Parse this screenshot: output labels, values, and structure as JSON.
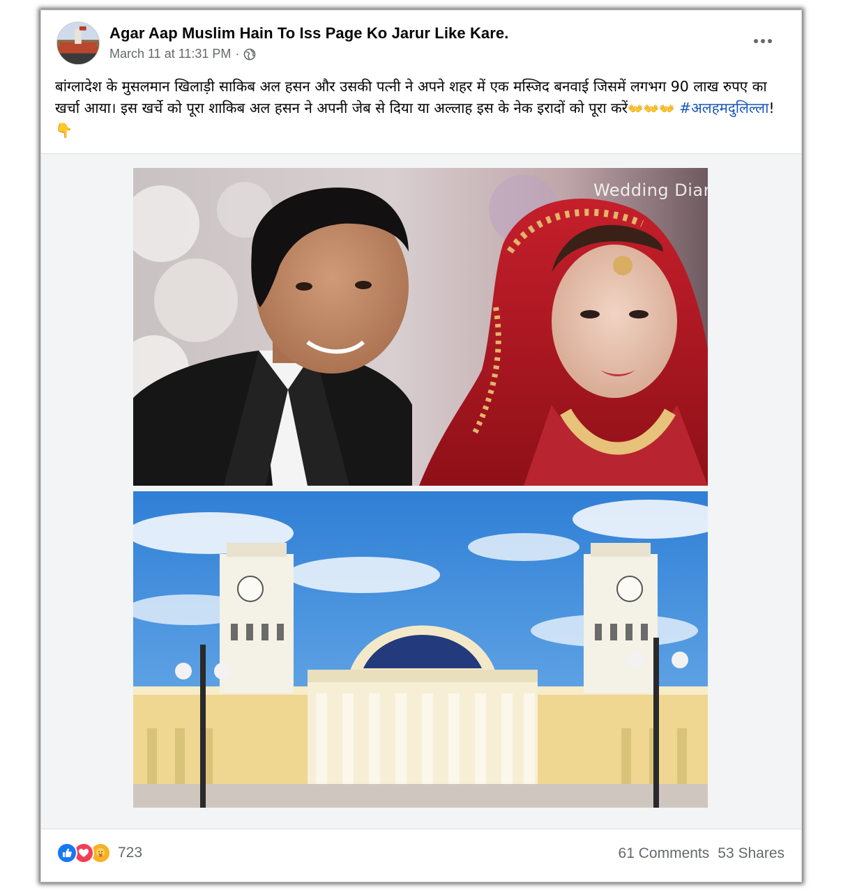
{
  "post": {
    "page_name": "Agar Aap Muslim Hain To Iss Page Ko Jarur Like Kare.",
    "timestamp": "March 11 at 11:31 PM",
    "separator": "·",
    "privacy_icon": "globe-icon",
    "text": "बांग्लादेश के मुसलमान खिलाड़ी साकिब अल हसन और उसकी पत्नी ने अपने शहर में एक मस्जिद बनवाई जिसमें लगभग 90 लाख रुपए का खर्चा आया। इस खर्चे को पूरा शाकिब अल हसन ने अपनी जेब से दिया या अल्लाह इस के नेक इरादों को पूरा करें",
    "emojis": "👐👐👐",
    "hashtag": "#अलहमदुलिल्ला",
    "trailing": "!👇"
  },
  "media": {
    "watermark": "Wedding Diar"
  },
  "footer": {
    "reaction_icons": [
      "like-icon",
      "love-icon",
      "care-icon"
    ],
    "reaction_count": "723",
    "comments": "61 Comments",
    "shares": "53 Shares"
  },
  "colors": {
    "like": "#1877f2",
    "love": "#f33e58",
    "care": "#f7b125",
    "hashtag": "#1a56b8",
    "secondary_text": "#65676b"
  }
}
